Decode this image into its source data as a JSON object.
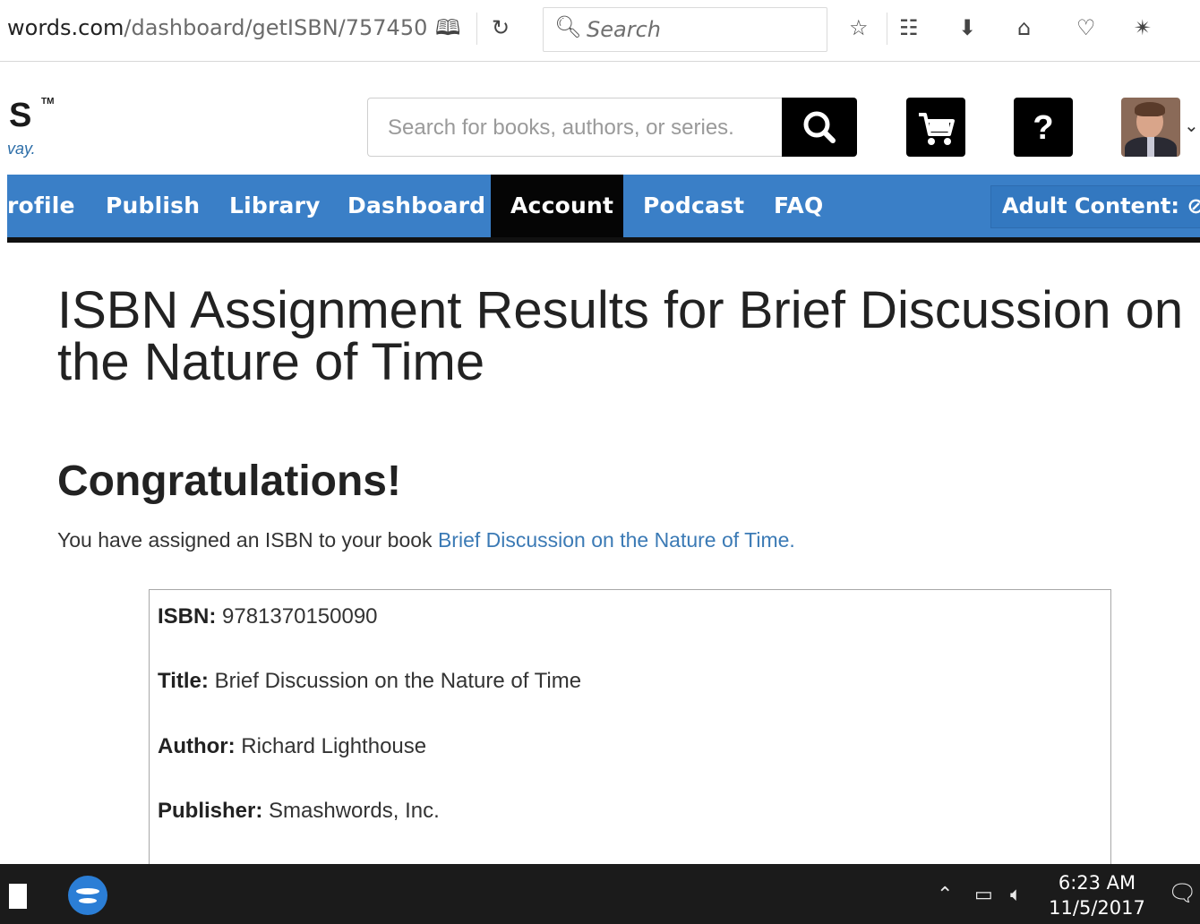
{
  "browser": {
    "url_domain": "words.com",
    "url_path": "/dashboard/getISBN/757450",
    "search_placeholder": "Search"
  },
  "header": {
    "logo_fragment": "S",
    "logo_tag": "vay.",
    "search_placeholder": "Search for books, authors, or series."
  },
  "nav": {
    "items": [
      "rofile",
      "Publish",
      "Library",
      "Dashboard",
      "Account",
      "Podcast",
      "FAQ"
    ],
    "active": "Account",
    "adult_content": "Adult Content: ⊘"
  },
  "page": {
    "title": "ISBN Assignment Results for Brief Discussion on the Nature of Time",
    "heading": "Congratulations!",
    "intro_text": "You have assigned an ISBN to your book ",
    "intro_link": "Brief Discussion on the Nature of Time."
  },
  "details": {
    "isbn_label": "ISBN:",
    "isbn_value": " 9781370150090",
    "title_label": "Title:",
    "title_value": " Brief Discussion on the Nature of Time",
    "author_label": "Author:",
    "author_value": " Richard Lighthouse",
    "publisher_label": "Publisher:",
    "publisher_value": " Smashwords, Inc."
  },
  "taskbar": {
    "time": "6:23 AM",
    "date": "11/5/2017"
  }
}
